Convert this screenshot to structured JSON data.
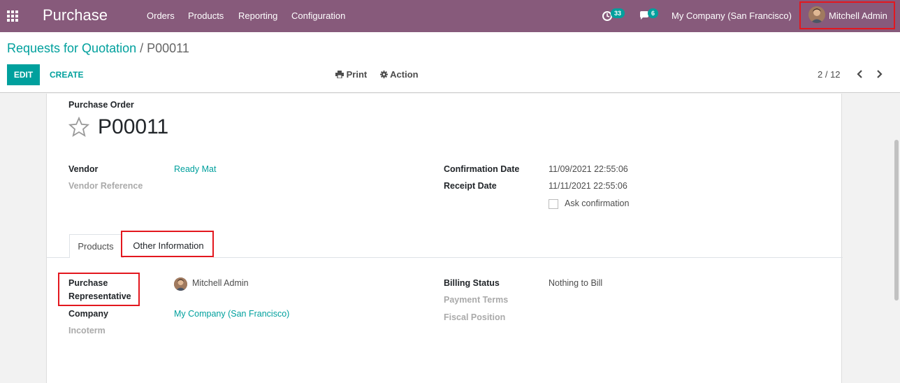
{
  "navbar": {
    "app_title": "Purchase",
    "menu": [
      "Orders",
      "Products",
      "Reporting",
      "Configuration"
    ],
    "activity_count": "33",
    "message_count": "6",
    "company": "My Company (San Francisco)",
    "user": "Mitchell Admin"
  },
  "breadcrumb": {
    "parent": "Requests for Quotation",
    "separator": "/",
    "current": "P00011"
  },
  "buttons": {
    "edit": "EDIT",
    "create": "CREATE",
    "print": "Print",
    "action": "Action"
  },
  "pager": {
    "value": "2 / 12"
  },
  "form": {
    "type_label": "Purchase Order",
    "name": "P00011",
    "vendor_label": "Vendor",
    "vendor": "Ready Mat",
    "vendor_ref_label": "Vendor Reference",
    "confirmation_date_label": "Confirmation Date",
    "confirmation_date": "11/09/2021 22:55:06",
    "receipt_date_label": "Receipt Date",
    "receipt_date": "11/11/2021 22:55:06",
    "ask_confirmation_label": "Ask confirmation",
    "tabs": [
      "Products",
      "Other Information"
    ],
    "rep_label_1": "Purchase",
    "rep_label_2": "Representative",
    "representative": "Mitchell Admin",
    "company_label": "Company",
    "company": "My Company (San Francisco)",
    "incoterm_label": "Incoterm",
    "billing_status_label": "Billing Status",
    "billing_status": "Nothing to Bill",
    "payment_terms_label": "Payment Terms",
    "fiscal_position_label": "Fiscal Position"
  },
  "colors": {
    "brand": "#875a7b",
    "accent": "#00a09d",
    "highlight": "#e3171e"
  }
}
